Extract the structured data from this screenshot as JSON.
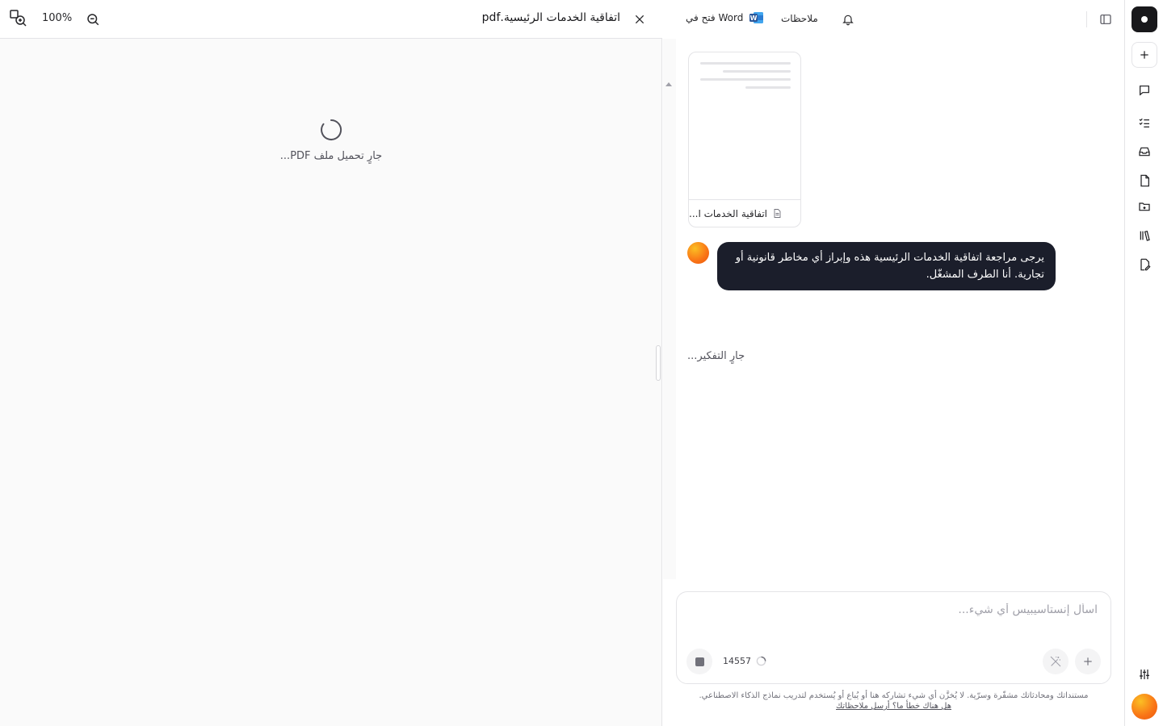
{
  "pdf_viewer": {
    "zoom_level": "100%",
    "title": "اتفاقية الخدمات الرئيسية.pdf",
    "loading_text": "جارٍ تحميل ملف PDF..."
  },
  "chat_header": {
    "open_in_word": "فتح في Word",
    "notes": "ملاحظات"
  },
  "attachment": {
    "name": "اتفاقية الخدمات ا..."
  },
  "messages": {
    "user_text": "يرجى مراجعة اتفاقية الخدمات الرئيسية هذه وإبراز أي مخاطر قانونية أو تجارية. أنا الطرف المشغّل.",
    "thinking": "جارٍ التفكير..."
  },
  "composer": {
    "placeholder": "اسأل إنستاسيبيس أي شيء...",
    "token_count": "14557"
  },
  "footer": {
    "disclaimer": "مستنداتك ومحادثاتك مشفّرة وسرّية. لا يُخزَّن أي شيء تشاركه هنا أو يُباع أو يُستخدم لتدريب نماذج الذكاء الاصطناعي.",
    "feedback": "هل هناك خطأ ما؟ أرسل ملاحظاتك"
  },
  "colors": {
    "user_bubble": "#1b1e2b",
    "avatar": "#f97316",
    "word_blue": "#2b579a"
  },
  "icons": [
    "zoom-in-icon",
    "zoom-out-icon",
    "close-icon",
    "spinner-icon",
    "word-icon",
    "bell-icon",
    "sidebar-toggle-icon",
    "file-icon",
    "stop-icon",
    "magic-wand-icon",
    "plus-icon",
    "chat-icon",
    "checklist-icon",
    "inbox-icon",
    "document-icon",
    "folder-icon",
    "library-icon",
    "edit-icon",
    "sliders-icon"
  ]
}
